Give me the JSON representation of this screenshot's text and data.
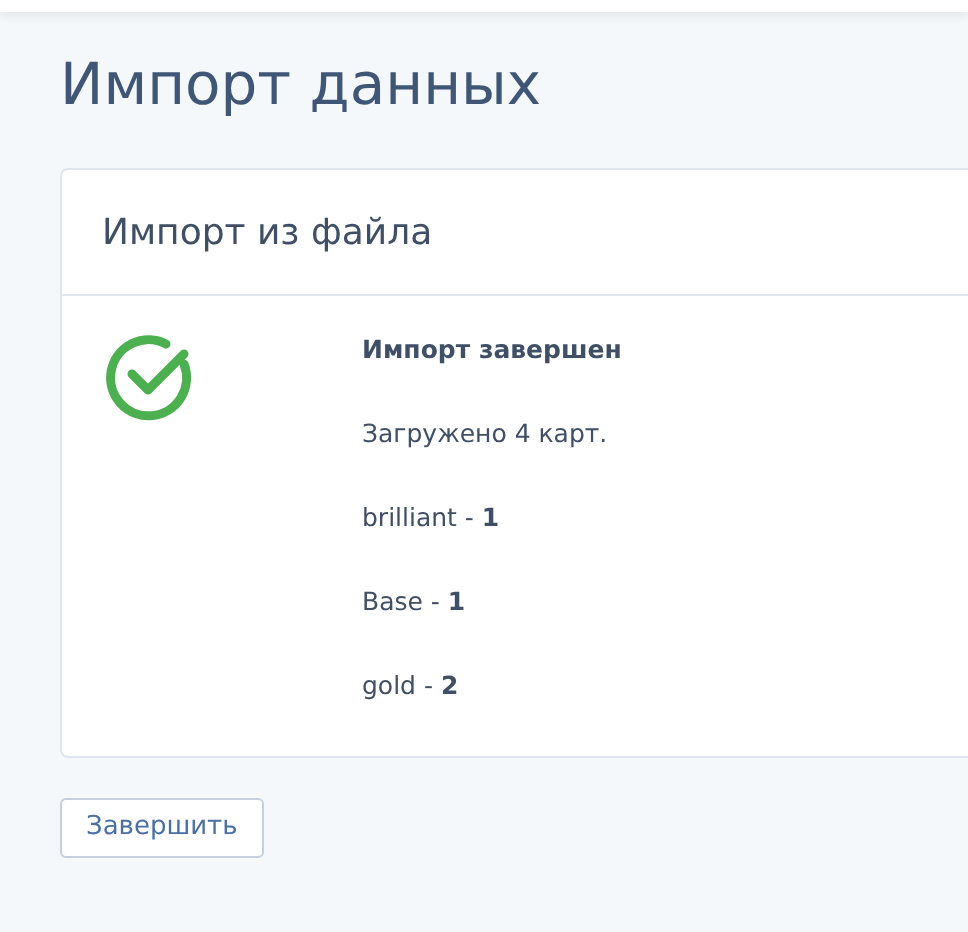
{
  "page": {
    "title": "Импорт данных"
  },
  "card": {
    "title": "Импорт из файла",
    "done": true,
    "heading": "Импорт завершен",
    "lines": [
      "Загружено 4 карт.",
      "brilliant - **1**",
      "Base - **1**",
      "gold - **2**"
    ]
  },
  "buttons": [
    "Завершить"
  ]
}
